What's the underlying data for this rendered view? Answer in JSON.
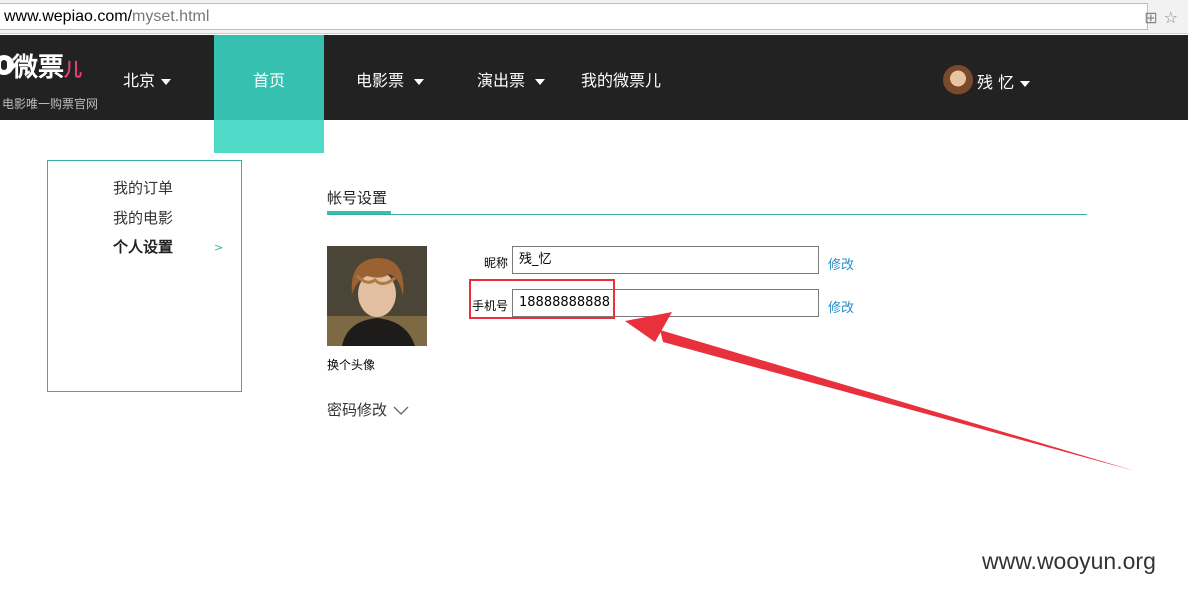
{
  "browser": {
    "url_host": "www.wepiao.com/",
    "url_path": "myset.html",
    "icons": [
      "translate-icon",
      "star-icon"
    ]
  },
  "header": {
    "logo_text": "微票",
    "logo_suffix": "儿",
    "slogan": "电影唯一购票官网",
    "city": "北京",
    "nav": {
      "home": "首页",
      "movie": "电影票",
      "show": "演出票",
      "mine": "我的微票儿"
    },
    "user_name": "残 忆"
  },
  "sidebar": {
    "items": [
      {
        "label": "我的订单"
      },
      {
        "label": "我的电影"
      },
      {
        "label": "个人设置"
      }
    ],
    "active_marker": ">"
  },
  "account": {
    "tab": "帐号设置",
    "change_avatar": "换个头像",
    "nickname": {
      "label": "昵称",
      "value": "残_忆",
      "edit": "修改"
    },
    "phone": {
      "label": "手机号",
      "value": "18888888888",
      "edit": "修改"
    },
    "password_toggle": "密码修改"
  },
  "watermark": "www.wooyun.org",
  "colors": {
    "nav_bg": "#222222",
    "accent": "#35c0b0",
    "link": "#2a8fc9",
    "annotation": "#e8313c"
  }
}
